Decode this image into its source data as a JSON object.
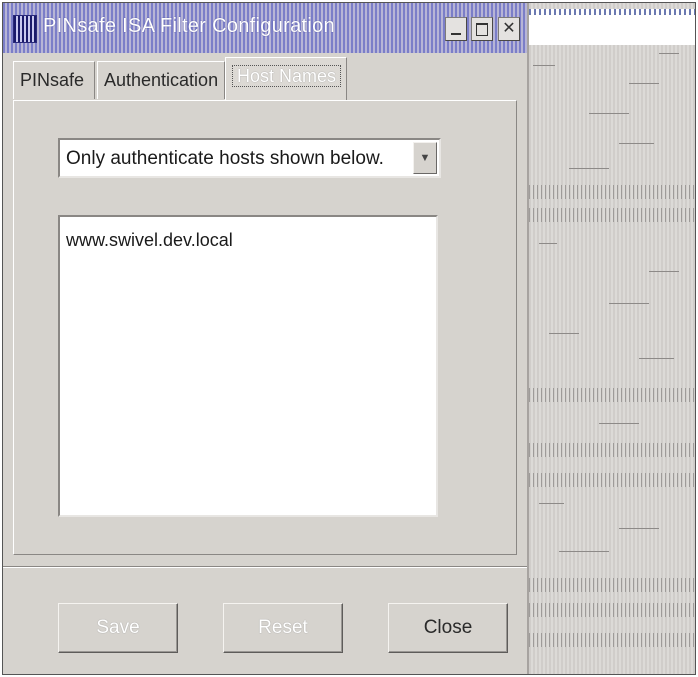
{
  "window": {
    "title": "PINsafe ISA Filter Configuration",
    "min_label": "",
    "max_label": "",
    "close_label": "✕"
  },
  "tabs": [
    {
      "label": "PINsafe"
    },
    {
      "label": "Authentication"
    },
    {
      "label": "Host Names",
      "selected": true
    }
  ],
  "host_filter": {
    "selected_option": "Only authenticate hosts shown below."
  },
  "host_list": [
    "www.swivel.dev.local"
  ],
  "buttons": {
    "save": "Save",
    "reset": "Reset",
    "close": "Close"
  },
  "colors": {
    "dialog_bg": "#d6d3ce",
    "titlebar": "#7b7ec8"
  }
}
